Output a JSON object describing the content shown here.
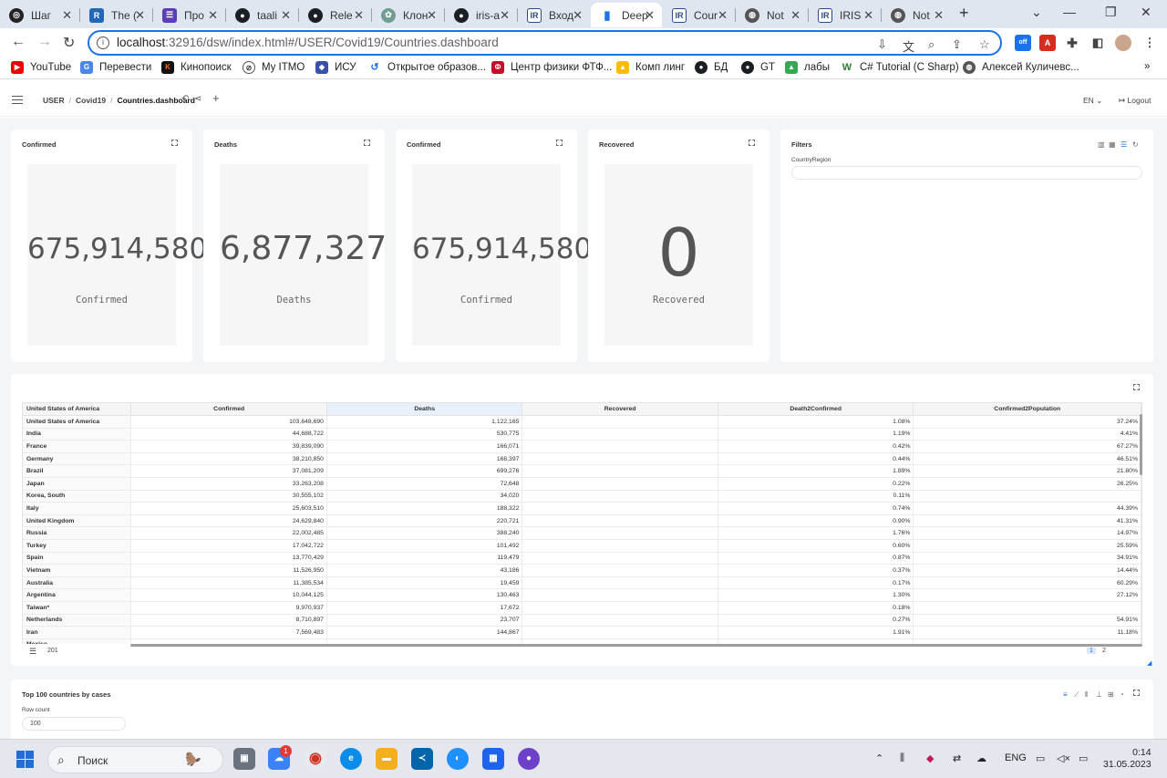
{
  "browser": {
    "tabs": [
      {
        "label": "Шаг",
        "active": false
      },
      {
        "label": "The (",
        "active": false
      },
      {
        "label": "Про",
        "active": false
      },
      {
        "label": "taali",
        "active": false
      },
      {
        "label": "Rele",
        "active": false
      },
      {
        "label": "Клон",
        "active": false
      },
      {
        "label": "iris-a",
        "active": false
      },
      {
        "label": "Вход",
        "active": false
      },
      {
        "label": "Deep",
        "active": true
      },
      {
        "label": "Cour",
        "active": false
      },
      {
        "label": "Not",
        "active": false
      },
      {
        "label": "IRIS",
        "active": false
      },
      {
        "label": "Not",
        "active": false
      }
    ],
    "url_host": "localhost",
    "url_path": ":32916/dsw/index.html#/USER/Covid19/Countries.dashboard",
    "extension_badge": "off",
    "bookmarks": [
      "YouTube",
      "Перевести",
      "Кинопоиск",
      "My ITMO",
      "ИСУ",
      "Открытое образов...",
      "Центр физики ФТФ...",
      "Комп линг",
      "БД",
      "GT",
      "лабы",
      "C# Tutorial (C Sharp)",
      "Алексей Куличевс..."
    ],
    "bookmarks_more": "»"
  },
  "app": {
    "breadcrumb": [
      "USER",
      "Covid19",
      "Countries.dashboard"
    ],
    "language": "EN",
    "logout_label": "Logout"
  },
  "kpis": [
    {
      "title": "Confirmed",
      "value": "675,914,580",
      "label": "Confirmed"
    },
    {
      "title": "Deaths",
      "value": "6,877,327",
      "label": "Deaths"
    },
    {
      "title": "Confirmed",
      "value": "675,914,580",
      "label": "Confirmed"
    },
    {
      "title": "Recovered",
      "value": "0",
      "label": "Recovered"
    }
  ],
  "filters": {
    "title": "Filters",
    "field_label": "CountryRegion",
    "field_value": ""
  },
  "table": {
    "columns": [
      "United States of America",
      "Confirmed",
      "Deaths",
      "Recovered",
      "Death2Confirmed",
      "Confirmed2Population"
    ],
    "highlighted_column": "Deaths",
    "rows": [
      [
        "United States of America",
        "103,648,690",
        "1,122,165",
        "",
        "1.08%",
        "37.24%"
      ],
      [
        "India",
        "44,688,722",
        "530,775",
        "",
        "1.19%",
        "4.41%"
      ],
      [
        "France",
        "39,839,090",
        "166,071",
        "",
        "0.42%",
        "67.27%"
      ],
      [
        "Germany",
        "38,210,850",
        "168,397",
        "",
        "0.44%",
        "46.51%"
      ],
      [
        "Brazil",
        "37,081,209",
        "699,276",
        "",
        "1.89%",
        "21.80%"
      ],
      [
        "Japan",
        "33,263,208",
        "72,648",
        "",
        "0.22%",
        "26.25%"
      ],
      [
        "Korea, South",
        "30,555,102",
        "34,020",
        "",
        "0.11%",
        ""
      ],
      [
        "Italy",
        "25,603,510",
        "188,322",
        "",
        "0.74%",
        "44.39%"
      ],
      [
        "United Kingdom",
        "24,629,840",
        "220,721",
        "",
        "0.90%",
        "41.31%"
      ],
      [
        "Russia",
        "22,002,485",
        "388,240",
        "",
        "1.76%",
        "14.97%"
      ],
      [
        "Turkey",
        "17,042,722",
        "101,492",
        "",
        "0.60%",
        "25.59%"
      ],
      [
        "Spain",
        "13,770,429",
        "119,479",
        "",
        "0.87%",
        "34.91%"
      ],
      [
        "Vietnam",
        "11,526,950",
        "43,186",
        "",
        "0.37%",
        "14.44%"
      ],
      [
        "Australia",
        "11,385,534",
        "19,459",
        "",
        "0.17%",
        "60.29%"
      ],
      [
        "Argentina",
        "10,044,125",
        "130,463",
        "",
        "1.30%",
        "27.12%"
      ],
      [
        "Taiwan*",
        "9,970,937",
        "17,672",
        "",
        "0.18%",
        ""
      ],
      [
        "Netherlands",
        "8,710,897",
        "23,707",
        "",
        "0.27%",
        "54.91%"
      ],
      [
        "Iran",
        "7,569,483",
        "144,867",
        "",
        "1.91%",
        "11.18%"
      ],
      [
        "Mexico",
        "",
        "",
        "",
        "",
        ""
      ]
    ],
    "row_count": "201",
    "pages": [
      "1",
      "2"
    ],
    "current_page": "1"
  },
  "bottom_widget": {
    "title": "Top 100 countries by cases",
    "row_count_label": "Row count",
    "row_count_value": "100"
  },
  "taskbar": {
    "search_label": "Поиск",
    "notification_count": "1",
    "language": "ENG",
    "time": "0:14",
    "date": "31.05.2023"
  },
  "colors": {
    "accent": "#1a73e8",
    "dashboard_bg": "#f4f5f7",
    "kpi_bg": "#f6f6f6",
    "highlight_header": "#e8f0fb"
  }
}
